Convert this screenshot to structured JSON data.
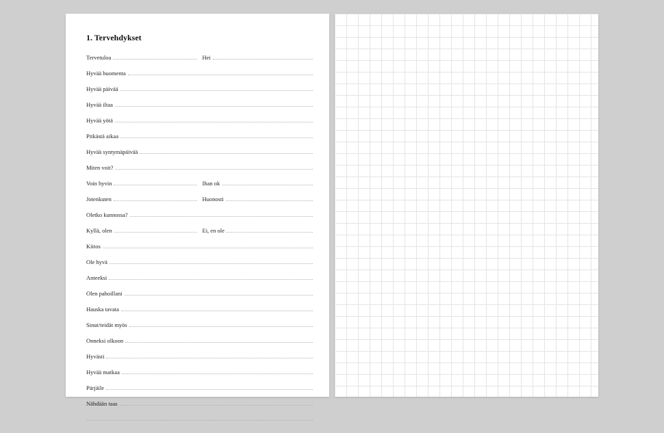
{
  "heading": "1. Tervehdykset",
  "rows": [
    {
      "type": "double",
      "items": [
        "Tervetuloa",
        "Hei"
      ]
    },
    {
      "type": "single",
      "items": [
        "Hyvää huomenta"
      ]
    },
    {
      "type": "single",
      "items": [
        "Hyvää päivää"
      ]
    },
    {
      "type": "single",
      "items": [
        "Hyvää iltaa"
      ]
    },
    {
      "type": "single",
      "items": [
        "Hyvää yötä"
      ]
    },
    {
      "type": "single",
      "items": [
        "Pitkästä aikaa"
      ]
    },
    {
      "type": "single",
      "items": [
        "Hyvää syntymäpäivää"
      ]
    },
    {
      "type": "single",
      "items": [
        "Miten voit?"
      ]
    },
    {
      "type": "double",
      "items": [
        "Voin hyvin",
        "Ihan ok"
      ]
    },
    {
      "type": "double",
      "items": [
        "Jotenkuten",
        "Huonosti"
      ]
    },
    {
      "type": "single",
      "items": [
        "Oletko kunnossa?"
      ]
    },
    {
      "type": "double",
      "items": [
        "Kyllä, olen",
        "Ei, en ole"
      ]
    },
    {
      "type": "single",
      "items": [
        "Kiitos"
      ]
    },
    {
      "type": "single",
      "items": [
        "Ole hyvä"
      ]
    },
    {
      "type": "single",
      "items": [
        "Anteeksi"
      ]
    },
    {
      "type": "single",
      "items": [
        "Olen pahoillani"
      ]
    },
    {
      "type": "single",
      "items": [
        "Hauska tavata"
      ]
    },
    {
      "type": "single",
      "items": [
        "Sinut/teidät myös"
      ]
    },
    {
      "type": "single",
      "items": [
        "Onneksi olkoon"
      ]
    },
    {
      "type": "single",
      "items": [
        "Hyvästi"
      ]
    },
    {
      "type": "single",
      "items": [
        "Hyvää matkaa"
      ]
    },
    {
      "type": "single",
      "items": [
        "Pärjäile"
      ]
    },
    {
      "type": "single",
      "items": [
        "Nähdään taas"
      ]
    },
    {
      "type": "blank",
      "items": [
        ""
      ]
    }
  ]
}
